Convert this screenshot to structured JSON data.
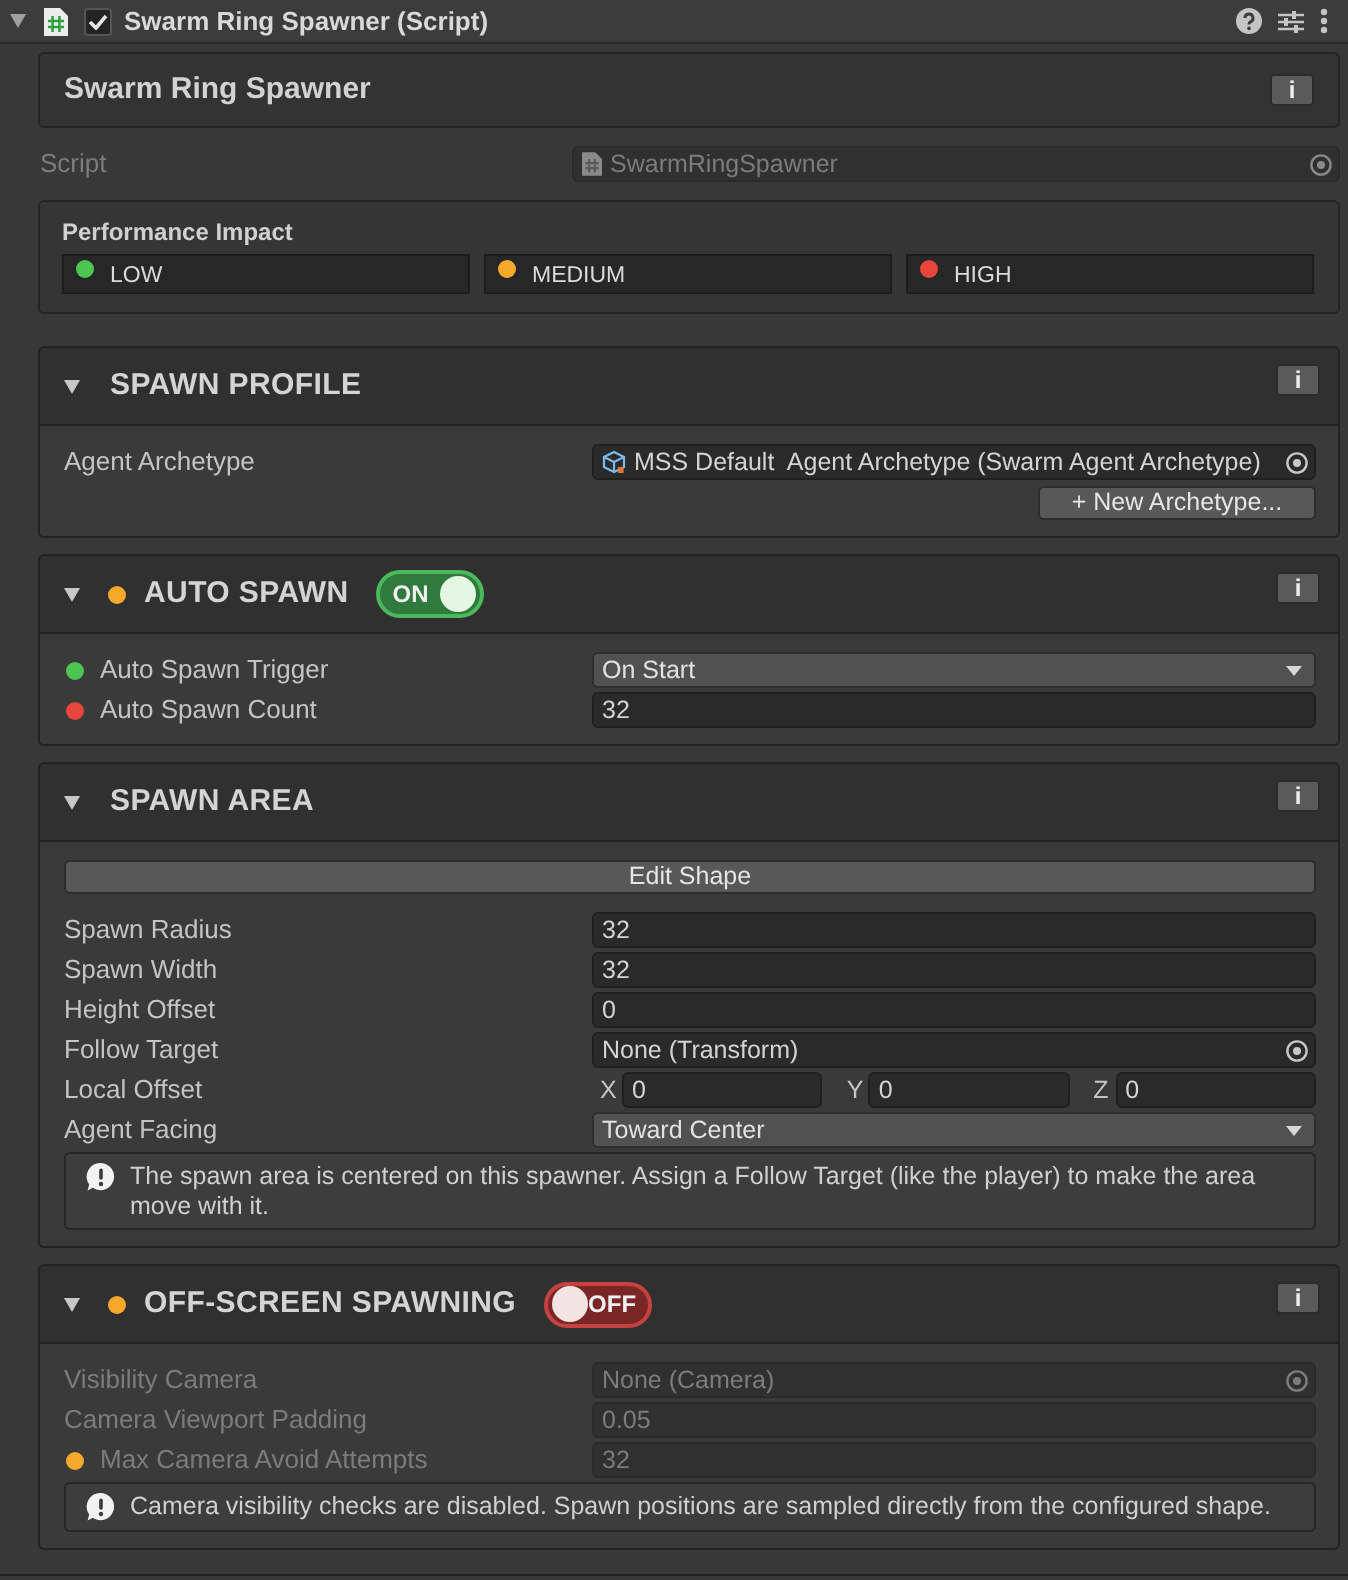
{
  "component": {
    "title": "Swarm Ring Spawner (Script)",
    "expanded": true,
    "enabled": true
  },
  "title_panel": {
    "title": "Swarm Ring Spawner",
    "info": "i"
  },
  "script": {
    "label": "Script",
    "value": "SwarmRingSpawner",
    "disabled": true
  },
  "performance_impact": {
    "title": "Performance Impact",
    "levels": [
      {
        "label": "LOW",
        "color": "#4cc552"
      },
      {
        "label": "MEDIUM",
        "color": "#f5a82a"
      },
      {
        "label": "HIGH",
        "color": "#e8453c"
      }
    ]
  },
  "sections": [
    {
      "title": "SPAWN PROFILE",
      "expanded": true,
      "info": "i",
      "rows": [
        {
          "kind": "asset",
          "label": "Agent Archetype",
          "value": "MSS Default  Agent Archetype (Swarm Agent Archetype)",
          "disabled": false
        },
        {
          "kind": "button",
          "label": "+ New Archetype...",
          "disabled": false
        }
      ]
    },
    {
      "title": "AUTO SPAWN",
      "expanded": true,
      "color": "#f5a82a",
      "toggle": {
        "on": true,
        "label": "ON"
      },
      "info": "i",
      "rows": [
        {
          "kind": "dropdown",
          "label": "Auto Spawn Trigger",
          "value": "On Start",
          "color": "#4cc552",
          "disabled": false
        },
        {
          "kind": "field",
          "label": "Auto Spawn Count",
          "value": "32",
          "color": "#e8453c",
          "disabled": false
        }
      ]
    },
    {
      "title": "SPAWN AREA",
      "expanded": true,
      "info": "i",
      "rows": [
        {
          "kind": "wide_button",
          "label": "Edit Shape",
          "disabled": false
        },
        {
          "kind": "field",
          "label": "Spawn Radius",
          "value": "32",
          "disabled": false
        },
        {
          "kind": "field",
          "label": "Spawn Width",
          "value": "32",
          "disabled": false
        },
        {
          "kind": "field",
          "label": "Height Offset",
          "value": "0",
          "disabled": false
        },
        {
          "kind": "object",
          "label": "Follow Target",
          "value": "None (Transform)",
          "disabled": false
        },
        {
          "kind": "vector3",
          "label": "Local Offset",
          "axes": [
            {
              "axis": "X",
              "value": "0"
            },
            {
              "axis": "Y",
              "value": "0"
            },
            {
              "axis": "Z",
              "value": "0"
            }
          ],
          "disabled": false
        },
        {
          "kind": "dropdown",
          "label": "Agent Facing",
          "value": "Toward Center",
          "disabled": false
        },
        {
          "kind": "help",
          "text": "The spawn area is centered on this spawner. Assign a Follow Target (like the player) to make the area move with it.",
          "disabled": false
        }
      ]
    },
    {
      "title": "OFF-SCREEN SPAWNING",
      "expanded": true,
      "color": "#f5a82a",
      "toggle": {
        "on": false,
        "label": "OFF"
      },
      "info": "i",
      "rows": [
        {
          "kind": "object",
          "label": "Visibility Camera",
          "value": "None (Camera)",
          "disabled": true
        },
        {
          "kind": "field",
          "label": "Camera Viewport Padding",
          "value": "0.05",
          "disabled": true
        },
        {
          "kind": "field",
          "label": "Max Camera Avoid Attempts",
          "value": "32",
          "color": "#f5a82a",
          "disabled": true
        },
        {
          "kind": "help",
          "text": "Camera visibility checks are disabled. Spawn positions are sampled directly from the configured shape.",
          "disabled": false
        }
      ]
    }
  ]
}
